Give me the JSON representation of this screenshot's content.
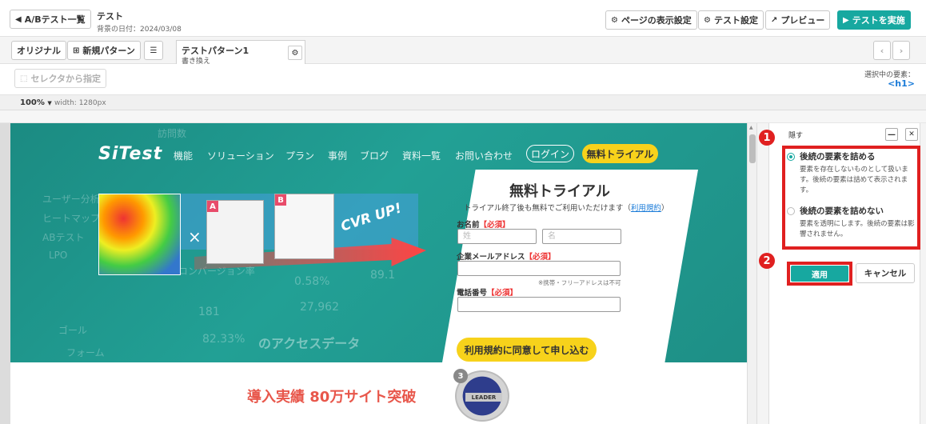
{
  "topbar": {
    "back_label": "A/Bテスト一覧",
    "test_name": "テスト",
    "background_date": "背景の日付：2024/03/08",
    "page_display_settings": "ページの表示設定",
    "test_settings": "テスト設定",
    "preview": "プレビュー",
    "run_test": "テストを実施"
  },
  "tabs": {
    "original": "オリジナル",
    "new_pattern": "新規パターン",
    "pattern_name": "テストパターン1",
    "pattern_sub": "書き換え"
  },
  "selector": {
    "button": "セレクタから指定",
    "selected_label": "選択中の要素：",
    "selected_value": "<h1>"
  },
  "zoom": {
    "level": "100%",
    "width": "width: 1280px"
  },
  "site": {
    "logo": "SiTest",
    "nav": [
      "機能",
      "ソリューション",
      "プラン",
      "事例",
      "ブログ",
      "資料一覧",
      "お問い合わせ"
    ],
    "login": "ログイン",
    "trial_nav": "無料トライアル",
    "cvr_up": "CVR UP!",
    "page_a_label": "A",
    "page_b_label": "B",
    "times": "×",
    "form": {
      "title": "無料トライアル",
      "desc_prefix": "トライアル終了後も無料でご利用いただけます（",
      "desc_link": "利用規約",
      "desc_suffix": "）",
      "name_label": "お名前",
      "required": "【必須】",
      "last_name_placeholder": "姓",
      "first_name_placeholder": "名",
      "email_label": "企業メールアドレス",
      "email_note": "※携帯・フリーアドレスは不可",
      "phone_label": "電話番号",
      "submit": "利用規約に同意して申し込む"
    },
    "results": "導入実績 80万サイト突破",
    "badge_text": "LEADER",
    "badge_num": "3",
    "bg_texts": [
      "ユーザー分析",
      "ヒートマップ",
      "ABテスト",
      "LPO",
      "コンバージョン率",
      "0.58%",
      "181",
      "27,962",
      "82.33%",
      "89.1",
      "のアクセスデータ",
      "訪問数",
      "ゴール",
      "フォーム"
    ]
  },
  "panel": {
    "title": "隠す",
    "annot1": "1",
    "annot2": "2",
    "opt1_title": "後続の要素を詰める",
    "opt1_desc": "要素を存在しないものとして扱います。後続の要素は詰めて表示されます。",
    "opt2_title": "後続の要素を詰めない",
    "opt2_desc": "要素を透明にします。後続の要素は影響されません。",
    "apply": "適用",
    "cancel": "キャンセル"
  },
  "colors": {
    "accent": "#17a8a0",
    "annotation_red": "#e02020",
    "cta_yellow": "#f7d21b"
  }
}
